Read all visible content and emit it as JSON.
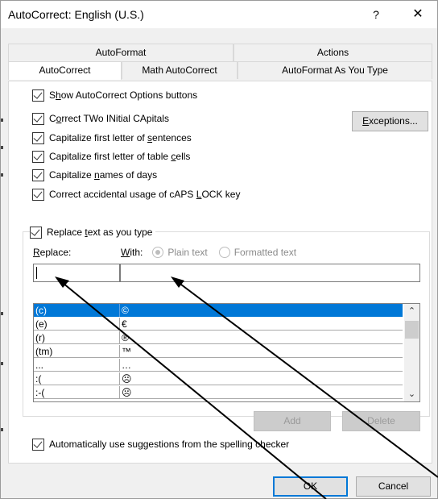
{
  "window": {
    "title": "AutoCorrect: English (U.S.)",
    "help": "?",
    "close": "✕"
  },
  "tabs": {
    "back": [
      "AutoFormat",
      "Actions"
    ],
    "front": [
      "AutoCorrect",
      "Math AutoCorrect",
      "AutoFormat As You Type"
    ],
    "active": "AutoCorrect"
  },
  "options": {
    "show_buttons_pre": "S",
    "show_buttons_u": "h",
    "show_buttons_post": "ow AutoCorrect Options buttons",
    "two_initial_pre": "C",
    "two_initial_u": "o",
    "two_initial_post": "rrect TWo INitial CApitals",
    "first_letter_pre": "Capitalize first letter of ",
    "first_letter_u": "s",
    "first_letter_post": "entences",
    "table_cells_pre": "Capitalize first letter of table ",
    "table_cells_u": "c",
    "table_cells_post": "ells",
    "days_pre": "Capitalize ",
    "days_u": "n",
    "days_post": "ames of days",
    "caps_lock_pre": "Correct accidental usage of cAPS ",
    "caps_lock_u": "L",
    "caps_lock_post": "OCK key",
    "exceptions_u": "E",
    "exceptions_post": "xceptions..."
  },
  "replace_section": {
    "replace_text_pre": "Replace ",
    "replace_text_u": "t",
    "replace_text_post": "ext as you type",
    "replace_label_u": "R",
    "replace_label_post": "eplace:",
    "with_label_u": "W",
    "with_label_post": "ith:",
    "plain_text": "Plain text",
    "formatted_text": "Formatted text",
    "replace_value": "",
    "with_value": ""
  },
  "entries": [
    {
      "replace": "(c)",
      "with": "©"
    },
    {
      "replace": "(e)",
      "with": "€"
    },
    {
      "replace": "(r)",
      "with": "®"
    },
    {
      "replace": "(tm)",
      "with": "™"
    },
    {
      "replace": "...",
      "with": "…"
    },
    {
      "replace": ":(",
      "with": "☹"
    },
    {
      "replace": ":-(",
      "with": "☹"
    }
  ],
  "buttons": {
    "add": "Add",
    "delete": "Delete",
    "ok": "OK",
    "cancel": "Cancel"
  },
  "spelling_pre": "Automatically use su",
  "spelling_u": "g",
  "spelling_post": "gestions from the spelling checker"
}
